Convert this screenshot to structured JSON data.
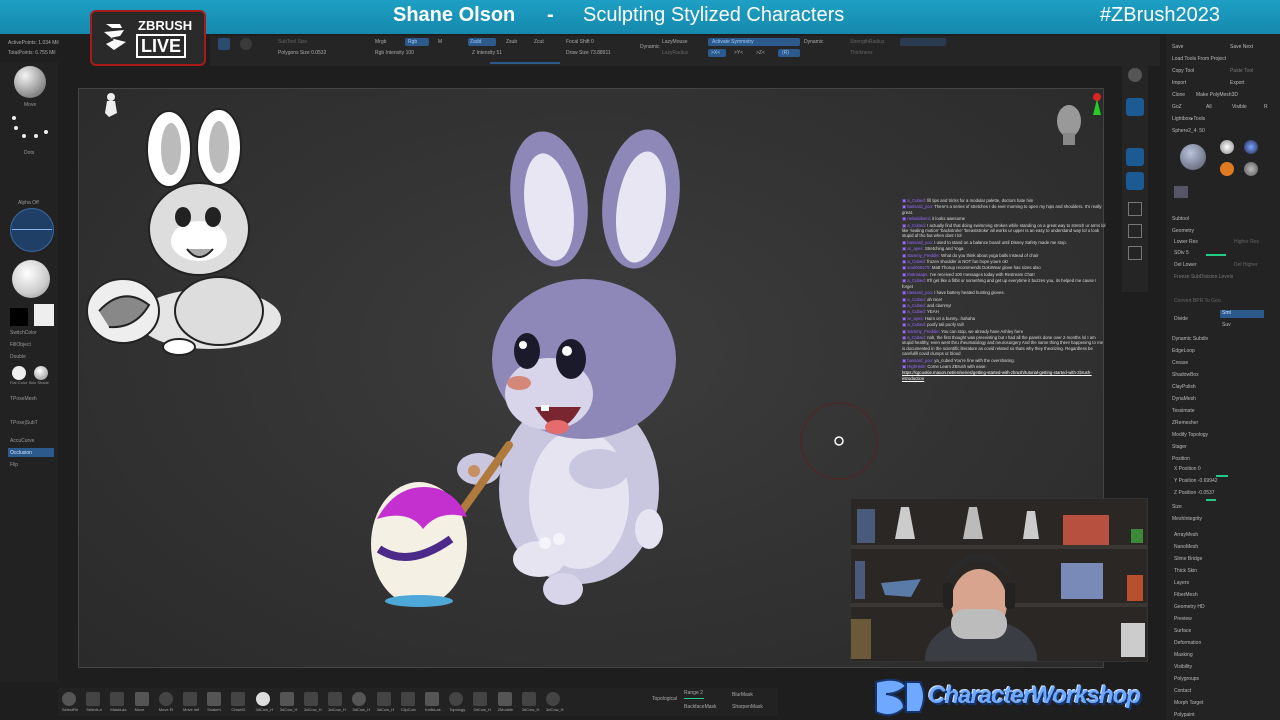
{
  "banner": {
    "host": "Shane Olson",
    "separator": "-",
    "topic": "Sculpting Stylized Characters",
    "hashtag": "#ZBrush2023"
  },
  "zbrush_logo": {
    "brand": "ZBRUSH",
    "live": "LIVE"
  },
  "top_info": {
    "active_points": "ActivePoints: 1.034 Mil",
    "total_points": "TotalPoints: 6.755 Mil"
  },
  "top_toolbar": {
    "subtool_size": "SubTool Size",
    "polygons_size": "Polygons Size 0.0532",
    "mrgb": "Mrgb",
    "rgb": "Rgb",
    "m": "M",
    "zadd": "Zadd",
    "zsub": "Zsub",
    "zcut": "Zcut",
    "rgb_intensity": "Rgb Intensity 100",
    "z_intensity": "Z Intensity 51",
    "focal_shift": "Focal Shift 0",
    "draw_size": "Draw Size 73.88911",
    "dynamic": "Dynamic",
    "lazy_mouse": "LazyMouse",
    "lazy_radius": "LazyRadius",
    "activate_symmetry": "Activate Symmetry",
    "x": ">X<",
    "y": ">Y<",
    "z": ">Z<",
    "m_sym": ">M<",
    "r": "(R)",
    "dynamic2": "Dynamic",
    "strength_radius": "StrengthRadius",
    "thickness": "Thickness"
  },
  "left_shelf": {
    "move": "Move",
    "dots": "Dots",
    "alpha_off": "Alpha Off",
    "switch_color": "SwitchColor",
    "fill_object": "FillObject",
    "double": "Double",
    "flat_color": "Flat Color Skin Shade",
    "tpose_mesh": "TPoseMesh",
    "tpose_subt": "TPose|SubT",
    "accu_curve": "AccuCurve",
    "occlusion": "Occlusion",
    "flip": "Flip"
  },
  "chat": [
    {
      "user": "a_Cubed:",
      "text": "fill tips and tricks for a modular palette, doctors hate him"
    },
    {
      "user": "bassard_yoo:",
      "text": "There's a series of stretches I do ever morning to open my hips and shoulders. It's really great."
    },
    {
      "user": "nelsabiksml:",
      "text": "it looks awesome"
    },
    {
      "user": "a_Cubed:",
      "text": "I actually find that doing swimming strokes while standing on a great way to stretch ur arms lol like 'sealing motion' 'backstroke' 'breaststroke' all works ur upper is an easy to understand way lol u look stupid af tho but when dont I lol"
    },
    {
      "user": "bassard_yoo:",
      "text": "I used to stand on a balance board until Disney Safety made me stop."
    },
    {
      "user": "ar_ayes:",
      "text": "Stretching and Yoga"
    },
    {
      "user": "Sammy_Freddie:",
      "text": "What do you think about yoga balls instead of chair"
    },
    {
      "user": "a_Cubed:",
      "text": "frozen shoulder is NOT fun hope youre ok!"
    },
    {
      "user": "soul000479:",
      "text": "Matt Thorup recommends DokiWear glove has sizes also"
    },
    {
      "user": "thotmaaps:",
      "text": "I've received 100 messages today with Restream Chat!"
    },
    {
      "user": "a_Cubed:",
      "text": "It'll get like a fitbit or something and get up everytime it buzzes you, its helped me cause I forget"
    },
    {
      "user": "bassard_yoo:",
      "text": "I have battery heated hunting gloves."
    },
    {
      "user": "a_Cubed:",
      "text": "ah nice!"
    },
    {
      "user": "a_Cubed:",
      "text": "and clammy!"
    },
    {
      "user": "a_Cubed:",
      "text": "YEAH"
    },
    {
      "user": "ar_ayes:",
      "text": "Hairs on a bunny...hahaha"
    },
    {
      "user": "a_Cubed:",
      "text": "poofy tail poofy tail!"
    },
    {
      "user": "Sammy_Freddie:",
      "text": "You can stop, we already have Ashley here"
    },
    {
      "user": "a_Cubed:",
      "text": "nah, the first thought was preexisting but I had all the panels done over 2 months lol I am stupid healthy, even went thru rheumatology and neurosurgery And the same thing there happening to me is documented in the scientific literature as covid related so thats why they theorizing. Regardless be carefullll covid clumps ur blood"
    },
    {
      "user": "bassard_yoo:",
      "text": "ya_cubed You're fine with the oversharing."
    },
    {
      "user": "HighHide:",
      "text": "Come Learn ZBrush with ease:"
    }
  ],
  "chat_link": "https://cgcookie.maxon.net/en/series/getting-started-with-zbrush/tutorial-getting-started-with-zbrush-introduction",
  "right_tray": {
    "save": "Save",
    "save_next": "Save Next",
    "load_tools": "Load Tools From Project",
    "copy_tool": "Copy Tool",
    "paste_tool": "Paste Tool",
    "import": "Import",
    "export": "Export",
    "clone": "Clone",
    "make_polymesh": "Make PolyMesh3D",
    "goz": "GoZ",
    "all": "All",
    "visible": "Visible",
    "r": "R",
    "lightbox_tools": "Lightbox▸Tools",
    "sphere_label": "Sphere2_4. 50",
    "subtool": "Subtool",
    "geometry": "Geometry",
    "lower_res": "Lower Res",
    "higher_res": "Higher Res",
    "sdiv": "SDiv 5",
    "del_lower": "Del Lower",
    "del_higher": "Del Higher",
    "freeze_subdiv": "Freeze SubDivision Levels",
    "convert_bpr": "Convert BPR To Geo",
    "divide": "Divide",
    "smt": "Smt",
    "suv": "Suv",
    "dynamic_subdiv": "Dynamic Subdiv",
    "edge_loop": "EdgeLoop",
    "crease": "Crease",
    "shadowbox": "ShadowBox",
    "claypolish": "ClayPolish",
    "dynamesh": "DynaMesh",
    "tessimate": "Tessimate",
    "zremesher": "ZRemesher",
    "modify_topology": "Modify Topology",
    "stager": "Stager",
    "position": "Position",
    "x_position": "X Position 0",
    "y_position": "Y Position -0.69942",
    "z_position": "Z Position -0.0537",
    "size": "Size",
    "mesh_integrity": "MeshIntegrity",
    "array_mesh": "ArrayMesh",
    "nano_mesh": "NanoMesh",
    "slime_bridge": "Slime Bridge",
    "thick_skin": "Thick Skin",
    "layers": "Layers",
    "fiber_mesh": "FiberMesh",
    "geometry_hd": "Geometry HD",
    "preview": "Preview",
    "surface": "Surface",
    "deformation": "Deformation",
    "masking": "Masking",
    "visibility": "Visibility",
    "polygroups": "Polygroups",
    "contact": "Contact",
    "morph_target": "Morph Target",
    "polypaint": "Polypaint"
  },
  "bottom_bar": {
    "labels": [
      "SelectRe",
      "SelectLa",
      "MaskLas",
      "Move",
      "Move El",
      "Move Infl",
      "Snakeh",
      "Chisel3",
      "3dCow_H",
      "3dCow_H",
      "3dCow_H",
      "3dCow_H",
      "3dCow_H",
      "3dCow_H",
      "ClipCurv",
      "KnifeLas",
      "Topology",
      "3dCow_H",
      "ZModele",
      "3dCow_H",
      "3dCow_H"
    ],
    "topological": "Topological",
    "range": "Range 2",
    "blur_mask": "BlurMask",
    "backface_mask": "BackfaceMask",
    "sharpen_mask": "SharpenMask"
  },
  "workshop_logo": {
    "text": "CharacterWorkshop"
  },
  "colors": {
    "banner": "#1e9fc4",
    "accent_blue": "#2d5a8c",
    "bunny_purple": "#8e88b8",
    "egg_magenta": "#c42fd0",
    "chat_user": "#9b6bff"
  }
}
